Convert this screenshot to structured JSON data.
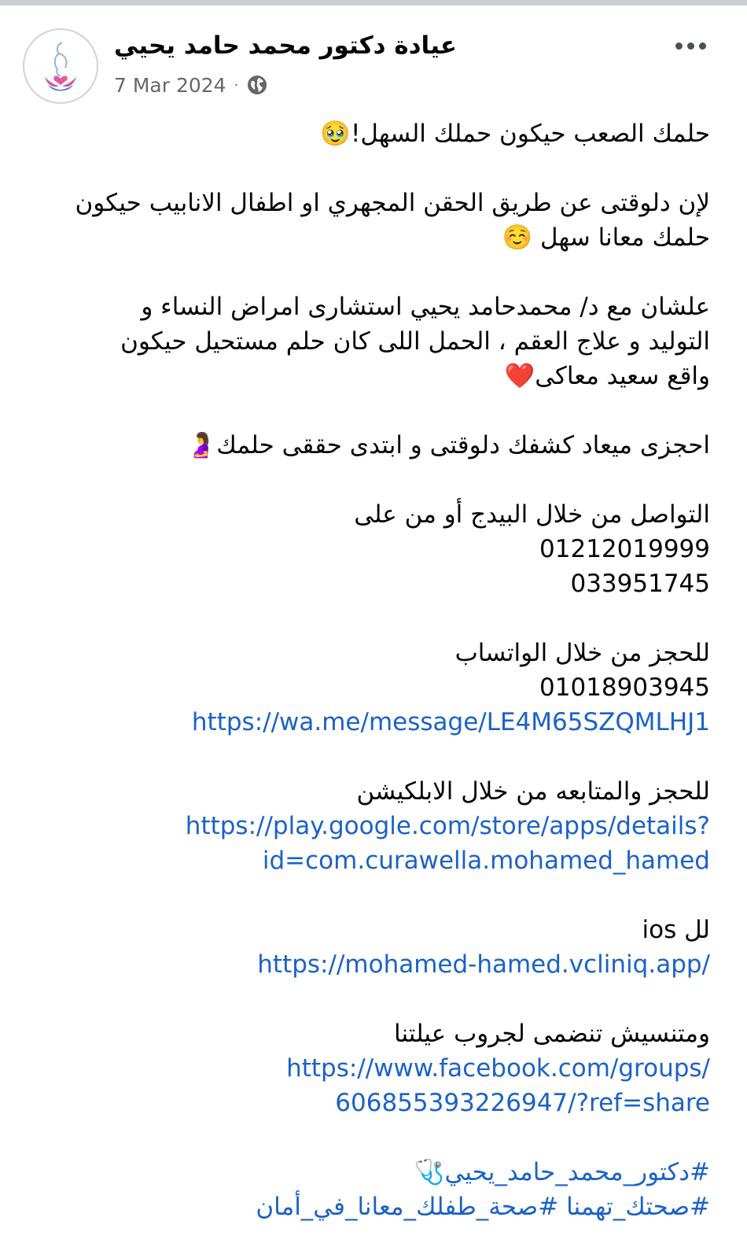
{
  "post": {
    "page_name": "عيادة دكتور محمد حامد يحيي",
    "date": "7 Mar 2024",
    "separator": "·",
    "privacy_icon": "globe-icon",
    "more_icon": "more-options-icon"
  },
  "content": {
    "line1": "حلمك الصعب حيكون حملك السهل!🥹",
    "line2": "لإن دلوقتى عن طريق الحقن المجهري او اطفال الانابيب حيكون",
    "line3": "حلمك معانا سهل ☺️",
    "line4": "علشان مع  د/ محمدحامد يحيي استشارى امراض النساء و",
    "line5": "التوليد و علاج العقم ، الحمل اللى كان حلم مستحيل حيكون",
    "line6": "واقع سعيد معاكى❤️",
    "line7": "احجزى ميعاد كشفك دلوقتى و ابتدى  حققى حلمك🤰",
    "line8": "التواصل من خلال البيدج أو من على",
    "phone1": "01212019999",
    "phone2": "033951745",
    "line9": "للحجز من خلال الواتساب",
    "phone3": "01018903945",
    "link_whatsapp": "https://wa.me/message/LE4M65SZQMLHJ1",
    "line10": "للحجز والمتابعه من خلال الابلكيشن",
    "link_play_1": "https://play.google.com/store/apps/details?",
    "link_play_2": "id=com.curawella.mohamed_hamed",
    "line11": "لل ios",
    "link_ios": "https://mohamed-hamed.vcliniq.app/",
    "line12": "ومتنسيش تنضمى لجروب عيلتنا",
    "link_fb_1": "https://www.facebook.com/groups/",
    "link_fb_2": "606855393226947/?ref=share",
    "hashtag1": "#دكتور_محمد_حامد_يحيي🩺",
    "hashtag2": "#صحتك_تهمنا #صحة_طفلك_معانا_في_أمان"
  }
}
